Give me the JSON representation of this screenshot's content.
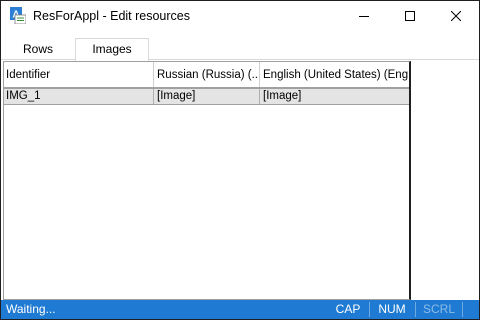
{
  "window": {
    "title": "ResForAppl - Edit resources",
    "app_icon": "resource-editor-icon"
  },
  "tabs": [
    {
      "label": "Rows",
      "selected": false
    },
    {
      "label": "Images",
      "selected": true
    }
  ],
  "grid": {
    "columns": [
      "Identifier",
      "Russian (Russia) (...",
      "English (United States) (Eng..."
    ],
    "rows": [
      [
        "IMG_1",
        "[Image]",
        "[Image]"
      ]
    ]
  },
  "status": {
    "text": "Waiting...",
    "indicators": {
      "cap": "CAP",
      "num": "NUM",
      "scrl": "SCRL"
    },
    "color": "#1e7ad2"
  }
}
